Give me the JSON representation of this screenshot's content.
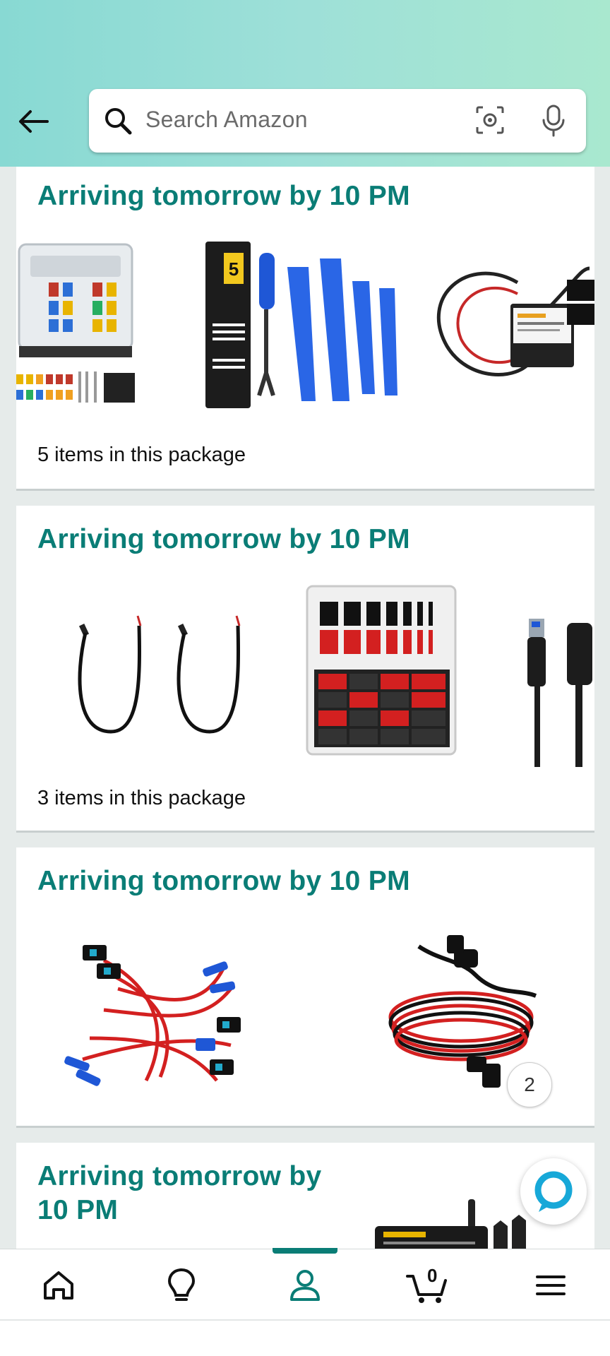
{
  "header": {
    "search_placeholder": "Search Amazon"
  },
  "cards": [
    {
      "title": "Arriving tomorrow by 10 PM",
      "count_text": "5 items in this package"
    },
    {
      "title": "Arriving tomorrow by 10 PM",
      "count_text": "3 items in this package"
    },
    {
      "title": "Arriving tomorrow by 10 PM",
      "more_badge": "2"
    },
    {
      "title_line1": "Arriving tomorrow by",
      "title_line2": "10 PM"
    }
  ],
  "nav": {
    "cart_count": "0",
    "active": "account"
  },
  "colors": {
    "accent": "#0a7d76",
    "header_gradient_start": "#88d9d3",
    "header_gradient_end": "#a9e8cf"
  }
}
